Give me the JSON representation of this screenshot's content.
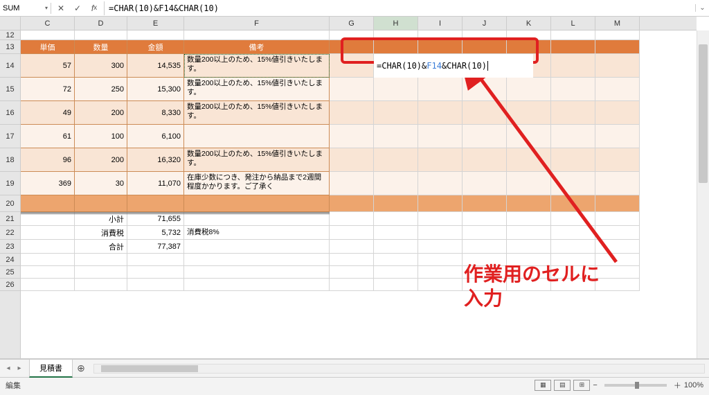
{
  "name_box": "SUM",
  "formula": "=CHAR(10)&F14&CHAR(10)",
  "cell_formula_parts": {
    "p1": "=CHAR(10)&",
    "ref": "F14",
    "p3": "&CHAR(10)"
  },
  "cols": [
    "C",
    "D",
    "E",
    "F",
    "G",
    "H",
    "I",
    "J",
    "K",
    "L",
    "M"
  ],
  "row_nums": [
    12,
    13,
    14,
    15,
    16,
    17,
    18,
    19,
    20,
    21,
    22,
    23,
    24,
    25,
    26
  ],
  "row_heights": {
    "12": 14,
    "13": 20,
    "14": 34,
    "15": 34,
    "16": 34,
    "17": 34,
    "18": 34,
    "19": 34,
    "20": 24,
    "21": 20,
    "22": 20,
    "23": 20,
    "24": 18,
    "25": 18,
    "26": 18
  },
  "headers": {
    "C": "単価",
    "D": "数量",
    "E": "金額",
    "F": "備考"
  },
  "rows_data": [
    {
      "r": 14,
      "c": "57",
      "d": "300",
      "e": "14,535",
      "f": "数量200以上のため、15%値引きいたします。",
      "stripe": "a"
    },
    {
      "r": 15,
      "c": "72",
      "d": "250",
      "e": "15,300",
      "f": "数量200以上のため、15%値引きいたします。",
      "stripe": "b"
    },
    {
      "r": 16,
      "c": "49",
      "d": "200",
      "e": "8,330",
      "f": "数量200以上のため、15%値引きいたします。",
      "stripe": "a"
    },
    {
      "r": 17,
      "c": "61",
      "d": "100",
      "e": "6,100",
      "f": "",
      "stripe": "b"
    },
    {
      "r": 18,
      "c": "96",
      "d": "200",
      "e": "16,320",
      "f": "数量200以上のため、15%値引きいたします。",
      "stripe": "a"
    },
    {
      "r": 19,
      "c": "369",
      "d": "30",
      "e": "11,070",
      "f": "在庫少数につき、発注から納品まで2週間程度かかります。ご了承く",
      "stripe": "b"
    }
  ],
  "totals": [
    {
      "r": 21,
      "label": "小計",
      "val": "71,655",
      "note": ""
    },
    {
      "r": 22,
      "label": "消費税",
      "val": "5,732",
      "note": "消費税8%"
    },
    {
      "r": 23,
      "label": "合計",
      "val": "77,387",
      "note": ""
    }
  ],
  "tab_name": "見積書",
  "status_text": "編集",
  "zoom": "100%",
  "annotation": "作業用のセルに\n入力"
}
